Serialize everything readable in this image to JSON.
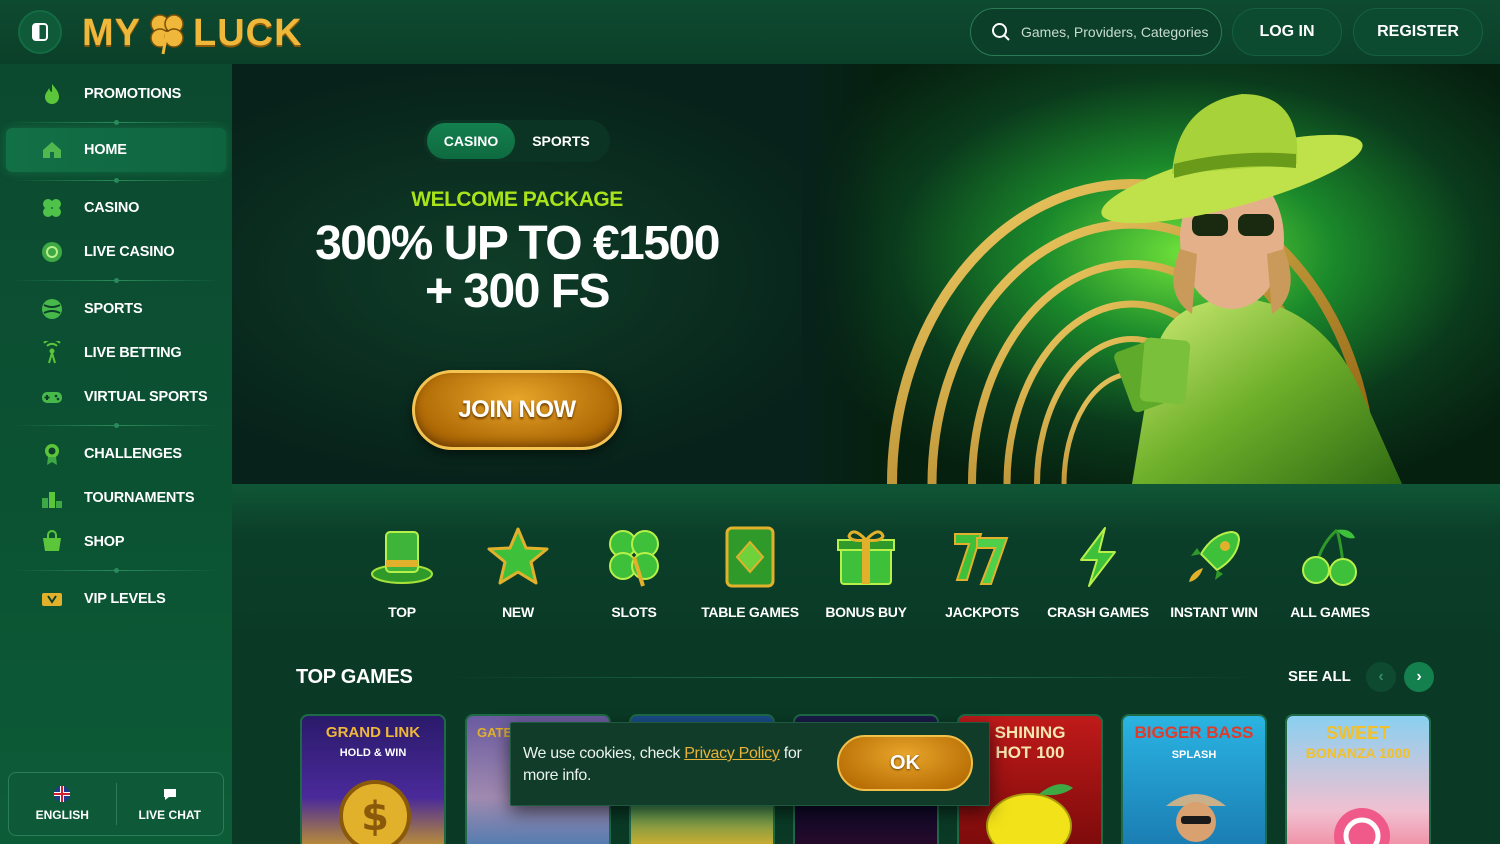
{
  "header": {
    "logo_text_left": "MY",
    "logo_text_right": "LUCK",
    "search_placeholder": "Games, Providers, Categories",
    "login_label": "LOG IN",
    "register_label": "REGISTER"
  },
  "sidebar": {
    "items": [
      {
        "label": "PROMOTIONS",
        "icon": "flame-icon"
      },
      {
        "label": "HOME",
        "icon": "home-icon",
        "active": true
      },
      {
        "label": "CASINO",
        "icon": "clover-icon"
      },
      {
        "label": "LIVE CASINO",
        "icon": "chip-icon"
      },
      {
        "label": "SPORTS",
        "icon": "ball-icon"
      },
      {
        "label": "LIVE BETTING",
        "icon": "broadcast-icon"
      },
      {
        "label": "VIRTUAL SPORTS",
        "icon": "gamepad-icon"
      },
      {
        "label": "CHALLENGES",
        "icon": "medal-icon"
      },
      {
        "label": "TOURNAMENTS",
        "icon": "podium-icon"
      },
      {
        "label": "SHOP",
        "icon": "bag-icon"
      },
      {
        "label": "VIP LEVELS",
        "icon": "ticket-icon"
      }
    ],
    "language_label": "ENGLISH",
    "chat_label": "LIVE CHAT"
  },
  "hero": {
    "tab_casino": "CASINO",
    "tab_sports": "SPORTS",
    "welcome": "WELCOME PACKAGE",
    "headline_line1": "300% UP TO €1500",
    "headline_line2": "+ 300 FS",
    "cta": "JOIN NOW"
  },
  "categories": [
    {
      "label": "TOP",
      "icon": "top-hat-icon"
    },
    {
      "label": "NEW",
      "icon": "star-icon"
    },
    {
      "label": "SLOTS",
      "icon": "clover-icon"
    },
    {
      "label": "TABLE GAMES",
      "icon": "card-icon"
    },
    {
      "label": "BONUS BUY",
      "icon": "gift-icon"
    },
    {
      "label": "JACKPOTS",
      "icon": "sevens-icon"
    },
    {
      "label": "CRASH GAMES",
      "icon": "lightning-icon"
    },
    {
      "label": "INSTANT WIN",
      "icon": "rocket-icon"
    },
    {
      "label": "ALL GAMES",
      "icon": "cherries-icon"
    }
  ],
  "top_games": {
    "title": "TOP GAMES",
    "see_all": "SEE ALL",
    "cards": [
      {
        "title": "GRAND LINK",
        "subtitle": "HOLD & WIN"
      },
      {
        "title": "GATES",
        "subtitle": ""
      },
      {
        "title": "",
        "subtitle": ""
      },
      {
        "title": "",
        "subtitle": ""
      },
      {
        "title": "SHINING",
        "subtitle": "HOT 100"
      },
      {
        "title": "BIGGER BASS",
        "subtitle": "SPLASH"
      },
      {
        "title": "SWEET",
        "subtitle": "BONANZA 1000"
      }
    ]
  },
  "cookie": {
    "text_before": "We use cookies, check ",
    "link": "Privacy Policy",
    "text_after": " for more info.",
    "ok": "OK"
  },
  "colors": {
    "bg": "#0a3a26",
    "accent_green": "#14804e",
    "gold": "#f0b83a",
    "lime": "#a9e41a"
  }
}
